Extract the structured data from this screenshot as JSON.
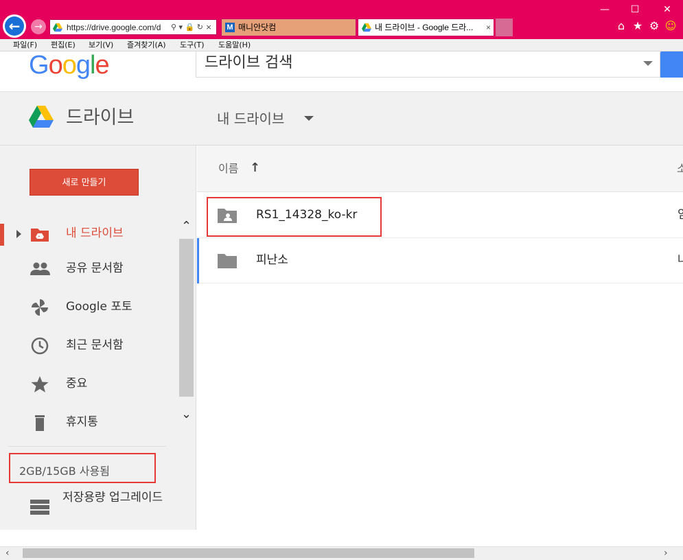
{
  "browser": {
    "url": "https://drive.google.com/d",
    "tabs": [
      {
        "label": "매니안닷컴",
        "icon": "maniahn-favicon"
      },
      {
        "label": "내 드라이브 - Google 드라...",
        "icon": "google-drive-favicon",
        "close": "×"
      }
    ],
    "menu": [
      "파일(F)",
      "편집(E)",
      "보기(V)",
      "즐겨찾기(A)",
      "도구(T)",
      "도움말(H)"
    ],
    "colors": {
      "frame": "#e5005c",
      "back_button": "#1a6fd6"
    }
  },
  "google": {
    "logo": "Google",
    "search_placeholder": "드라이브 검색"
  },
  "drive": {
    "title": "드라이브",
    "location": "내 드라이브",
    "new_button": "새로 만들기",
    "nav": [
      {
        "label": "내 드라이브",
        "icon": "my-drive-icon",
        "active": true
      },
      {
        "label": "공유 문서함",
        "icon": "shared-people-icon"
      },
      {
        "label": "Google 포토",
        "icon": "google-photos-icon"
      },
      {
        "label": "최근 문서함",
        "icon": "clock-icon"
      },
      {
        "label": "중요",
        "icon": "star-icon"
      },
      {
        "label": "휴지통",
        "icon": "trash-icon"
      }
    ],
    "storage": "2GB/15GB 사용됨",
    "upgrade": "저장용량 업그레이드",
    "list": {
      "column_name": "이름",
      "column_right": "소",
      "rows": [
        {
          "name": "RS1_14328_ko-kr",
          "icon": "shared-folder-icon",
          "right": "임"
        },
        {
          "name": "피난소",
          "icon": "folder-icon",
          "right": "나"
        }
      ]
    },
    "accent": "#dd4b39"
  }
}
